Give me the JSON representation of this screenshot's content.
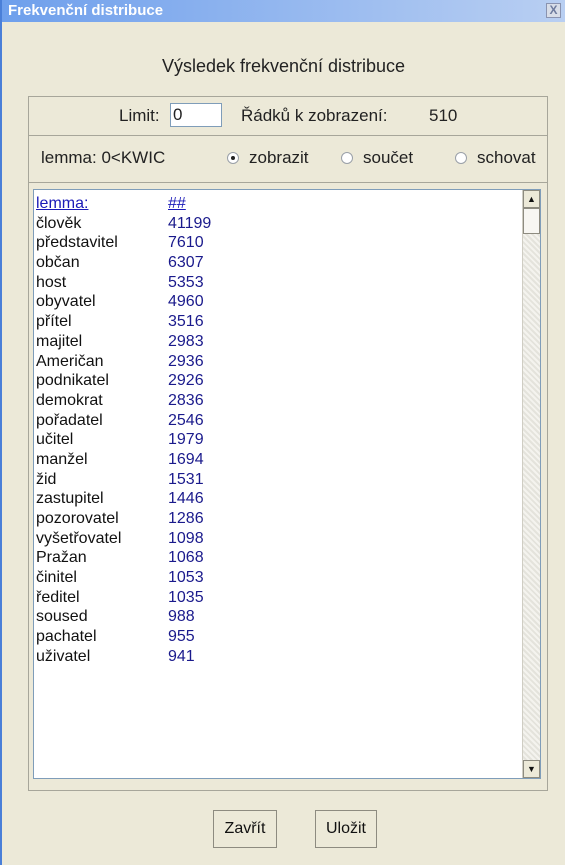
{
  "window": {
    "title": "Frekvenční distribuce",
    "close_glyph": "X"
  },
  "heading": "Výsledek frekvenční distribuce",
  "limit": {
    "label": "Limit:",
    "value": "0",
    "rows_label": "Řádků k zobrazení:",
    "rows_value": "510"
  },
  "display": {
    "label": "lemma: 0<KWIC",
    "options": [
      {
        "label": "zobrazit",
        "selected": true
      },
      {
        "label": "součet",
        "selected": false
      },
      {
        "label": "schovat",
        "selected": false
      }
    ]
  },
  "table": {
    "headers": [
      "lemma:",
      "##"
    ],
    "rows": [
      [
        "člověk",
        "41199"
      ],
      [
        "představitel",
        "7610"
      ],
      [
        "občan",
        "6307"
      ],
      [
        "host",
        "5353"
      ],
      [
        "obyvatel",
        "4960"
      ],
      [
        "přítel",
        "3516"
      ],
      [
        "majitel",
        "2983"
      ],
      [
        "Američan",
        "2936"
      ],
      [
        "podnikatel",
        "2926"
      ],
      [
        "demokrat",
        "2836"
      ],
      [
        "pořadatel",
        "2546"
      ],
      [
        "učitel",
        "1979"
      ],
      [
        "manžel",
        "1694"
      ],
      [
        "žid",
        "1531"
      ],
      [
        "zastupitel",
        "1446"
      ],
      [
        "pozorovatel",
        "1286"
      ],
      [
        "vyšetřovatel",
        "1098"
      ],
      [
        "Pražan",
        "1068"
      ],
      [
        "činitel",
        "1053"
      ],
      [
        "ředitel",
        "1035"
      ],
      [
        "soused",
        "988"
      ],
      [
        "pachatel",
        "955"
      ],
      [
        "uživatel",
        "941"
      ]
    ]
  },
  "buttons": {
    "close_label": "Zavřít",
    "save_label": "Uložit"
  }
}
